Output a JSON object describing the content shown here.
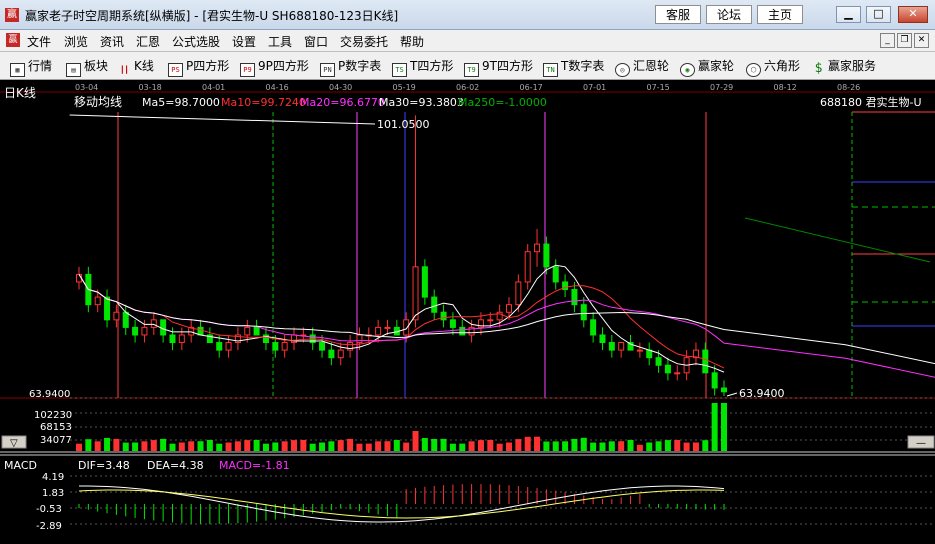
{
  "window": {
    "title": "赢家老子时空周期系统[纵横版] - [君实生物-U   SH688180-123日K线]",
    "buttons": [
      "客服",
      "论坛",
      "主页"
    ]
  },
  "menu": [
    "文件",
    "浏览",
    "资讯",
    "汇恩",
    "公式选股",
    "设置",
    "工具",
    "窗口",
    "交易委托",
    "帮助"
  ],
  "toolbar": [
    {
      "label": "行情",
      "icon": "grid-icon"
    },
    {
      "label": "板块",
      "icon": "blocks-icon"
    },
    {
      "label": "K线",
      "icon": "candle-icon"
    },
    {
      "label": "P四方形",
      "icon": "p-square-icon",
      "tag": "PS"
    },
    {
      "label": "9P四方形",
      "icon": "9p-square-icon",
      "tag": "P9"
    },
    {
      "label": "P数字表",
      "icon": "p-number-icon",
      "tag": "PN"
    },
    {
      "label": "T四方形",
      "icon": "t-square-icon",
      "tag": "TS"
    },
    {
      "label": "9T四方形",
      "icon": "9t-square-icon",
      "tag": "T9"
    },
    {
      "label": "T数字表",
      "icon": "t-number-icon",
      "tag": "TN"
    },
    {
      "label": "汇恩轮",
      "icon": "wheel-icon"
    },
    {
      "label": "赢家轮",
      "icon": "winner-wheel-icon"
    },
    {
      "label": "六角形",
      "icon": "hexagon-icon"
    },
    {
      "label": "赢家服务",
      "icon": "dollar-icon"
    }
  ],
  "kline": {
    "period_label": "日K线",
    "indicator_name": "移动均线",
    "ma": [
      {
        "label": "Ma5=98.7000",
        "color": "#ffffff"
      },
      {
        "label": "Ma10=99.7240",
        "color": "#ff3030"
      },
      {
        "label": "Ma20=96.6770",
        "color": "#ff30ff"
      },
      {
        "label": "Ma30=93.3803",
        "color": "#ffffff"
      },
      {
        "label": "Ma250=-1.0000",
        "color": "#00b000"
      }
    ],
    "stock": "688180  君实生物-U",
    "dates": [
      "03-04",
      "03-18",
      "04-01",
      "04-16",
      "04-30",
      "05-19",
      "06-02",
      "06-17",
      "07-01",
      "07-15",
      "07-29",
      "08-12",
      "08-26"
    ],
    "high_label": "101.0500",
    "low_label": "63.9400",
    "axis_low": "63.9400",
    "volume_ticks": [
      "102230",
      "68153",
      "34077"
    ]
  },
  "macd": {
    "name": "MACD",
    "dif": "DIF=3.48",
    "dea": "DEA=4.38",
    "macd": "MACD=-1.81",
    "ticks": [
      "4.19",
      "1.83",
      "-0.53",
      "-2.89"
    ]
  },
  "chart_data": {
    "type": "candlestick",
    "candles": [
      [
        79,
        81,
        78,
        80
      ],
      [
        80,
        81,
        75,
        76
      ],
      [
        76,
        78,
        75,
        77
      ],
      [
        77,
        78,
        73,
        74
      ],
      [
        74,
        76,
        73,
        75
      ],
      [
        75,
        76,
        72,
        73
      ],
      [
        73,
        74,
        71,
        72
      ],
      [
        72,
        74,
        71,
        73
      ],
      [
        73,
        75,
        72,
        74
      ],
      [
        74,
        74,
        71,
        72
      ],
      [
        72,
        73,
        70,
        71
      ],
      [
        71,
        73,
        70,
        72
      ],
      [
        72,
        74,
        71,
        73
      ],
      [
        73,
        74,
        72,
        72
      ],
      [
        72,
        73,
        71,
        71
      ],
      [
        71,
        72,
        69,
        70
      ],
      [
        70,
        72,
        69,
        71
      ],
      [
        71,
        73,
        70,
        72
      ],
      [
        72,
        74,
        71,
        73
      ],
      [
        73,
        74,
        72,
        72
      ],
      [
        72,
        73,
        70,
        71
      ],
      [
        71,
        72,
        69,
        70
      ],
      [
        70,
        72,
        69,
        71
      ],
      [
        71,
        73,
        70,
        72
      ],
      [
        72,
        73,
        71,
        72
      ],
      [
        72,
        73,
        70,
        71
      ],
      [
        71,
        72,
        69,
        70
      ],
      [
        70,
        71,
        68,
        69
      ],
      [
        69,
        71,
        68,
        70
      ],
      [
        70,
        72,
        69,
        71
      ],
      [
        71,
        73,
        70,
        72
      ],
      [
        72,
        73,
        71,
        72
      ],
      [
        72,
        74,
        71,
        73
      ],
      [
        73,
        74,
        72,
        73
      ],
      [
        73,
        74,
        72,
        72
      ],
      [
        72,
        75,
        71,
        74
      ],
      [
        74,
        101,
        73,
        81
      ],
      [
        81,
        82,
        76,
        77
      ],
      [
        77,
        78,
        74,
        75
      ],
      [
        75,
        76,
        73,
        74
      ],
      [
        74,
        75,
        72,
        73
      ],
      [
        73,
        74,
        72,
        72
      ],
      [
        72,
        74,
        71,
        73
      ],
      [
        73,
        75,
        72,
        74
      ],
      [
        74,
        75,
        73,
        74
      ],
      [
        74,
        76,
        73,
        75
      ],
      [
        75,
        77,
        74,
        76
      ],
      [
        76,
        80,
        75,
        79
      ],
      [
        79,
        84,
        78,
        83
      ],
      [
        83,
        86,
        81,
        84
      ],
      [
        84,
        85,
        80,
        81
      ],
      [
        81,
        82,
        78,
        79
      ],
      [
        79,
        80,
        77,
        78
      ],
      [
        78,
        79,
        75,
        76
      ],
      [
        76,
        77,
        73,
        74
      ],
      [
        74,
        75,
        71,
        72
      ],
      [
        72,
        73,
        70,
        71
      ],
      [
        71,
        72,
        69,
        70
      ],
      [
        70,
        71,
        69,
        71
      ],
      [
        71,
        72,
        70,
        70
      ],
      [
        70,
        71,
        69,
        70
      ],
      [
        70,
        71,
        68,
        69
      ],
      [
        69,
        70,
        67,
        68
      ],
      [
        68,
        69,
        66,
        67
      ],
      [
        67,
        68,
        66,
        67
      ],
      [
        67,
        70,
        66,
        69
      ],
      [
        69,
        71,
        68,
        70
      ],
      [
        70,
        71,
        67,
        67
      ],
      [
        67,
        68,
        64,
        65
      ],
      [
        65,
        66,
        63.94,
        64.5
      ]
    ],
    "ma_values": {
      "ma5": 98.7,
      "ma10": 99.724,
      "ma20": 96.677,
      "ma30": 93.3803,
      "ma250": -1.0
    },
    "ylim": [
      63.94,
      101.05
    ],
    "macd_ylim": [
      -2.89,
      4.19
    ]
  }
}
